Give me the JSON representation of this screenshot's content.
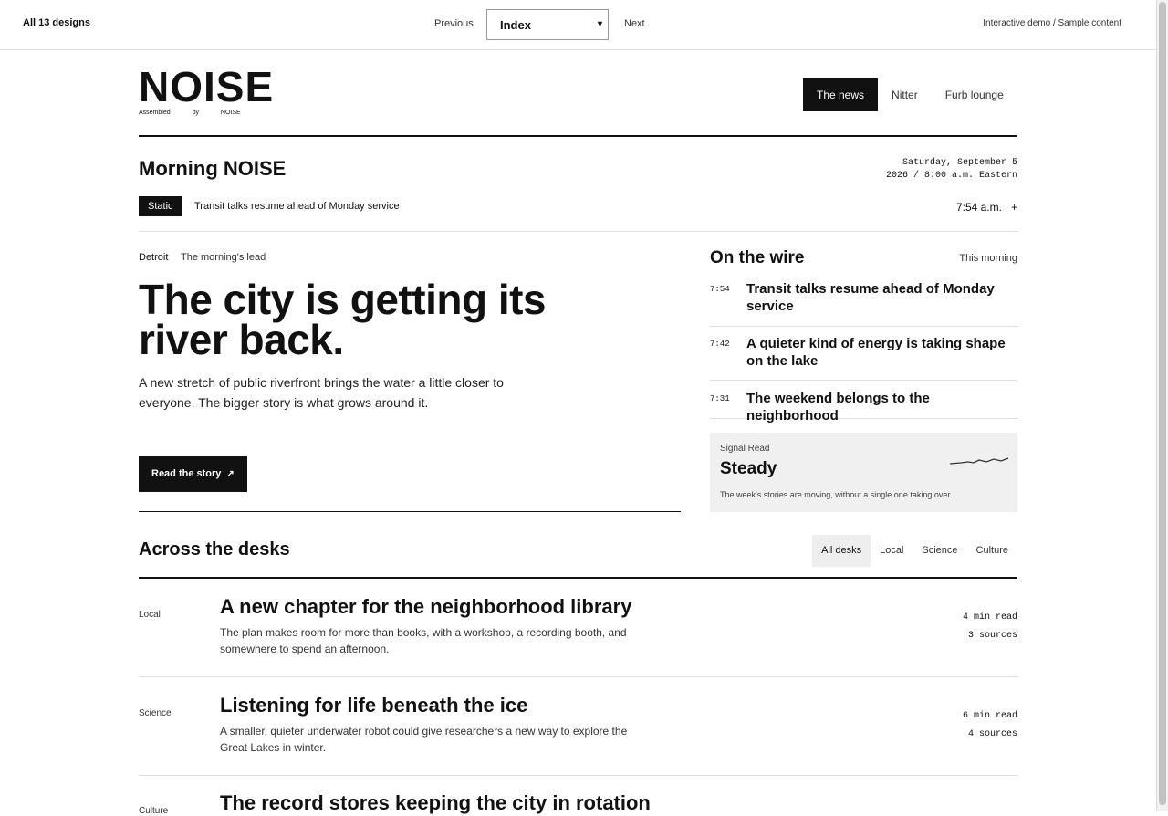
{
  "topbar": {
    "all_designs": "All 13 designs",
    "previous": "Previous",
    "select_value": "Index",
    "next": "Next",
    "demo_note": "Interactive demo / Sample content"
  },
  "brand": {
    "logo": "NOISE",
    "tagline": "Assembled by NOISE"
  },
  "nav": {
    "items": [
      "The news",
      "Nitter",
      "Furb lounge"
    ]
  },
  "edition": {
    "title": "Morning NOISE",
    "dateline": "Saturday, September 5 2026 / 8:00 a.m. Eastern",
    "static_label": "Static",
    "ticker": "Transit talks resume ahead of Monday service",
    "clock": "7:54 a.m.",
    "clock_toggle": "+"
  },
  "lead": {
    "location": "Detroit",
    "label": "The morning's lead",
    "headline": "The city is getting its river back.",
    "dek": "A new stretch of public riverfront brings the water a little closer to everyone. The bigger story is what grows around it.",
    "cta": "Read the story",
    "cta_icon": "arrow-up-right-icon"
  },
  "wire": {
    "title": "On the wire",
    "when": "This morning",
    "items": [
      {
        "time": "7:54",
        "headline": "Transit talks resume ahead of Monday service"
      },
      {
        "time": "7:42",
        "headline": "A quieter kind of energy is taking shape on the lake"
      },
      {
        "time": "7:31",
        "headline": "The weekend belongs to the neighborhood"
      }
    ]
  },
  "signal": {
    "label": "Signal Read",
    "value": "Steady",
    "note": "The week's stories are moving, without a single one taking over."
  },
  "desks": {
    "title": "Across the desks",
    "tabs": [
      "All desks",
      "Local",
      "Science",
      "Culture"
    ],
    "stories": [
      {
        "desk": "Local",
        "headline": "A new chapter for the neighborhood library",
        "dek": "The plan makes room for more than books, with a workshop, a recording booth, and somewhere to spend an afternoon.",
        "read": "4 min read",
        "sources": "3 sources"
      },
      {
        "desk": "Science",
        "headline": "Listening for life beneath the ice",
        "dek": "A smaller, quieter underwater robot could give researchers a new way to explore the Great Lakes in winter.",
        "read": "6 min read",
        "sources": "4 sources"
      },
      {
        "desk": "Culture",
        "headline": "The record stores keeping the city in rotation",
        "dek": "",
        "read": "",
        "sources": ""
      }
    ]
  }
}
